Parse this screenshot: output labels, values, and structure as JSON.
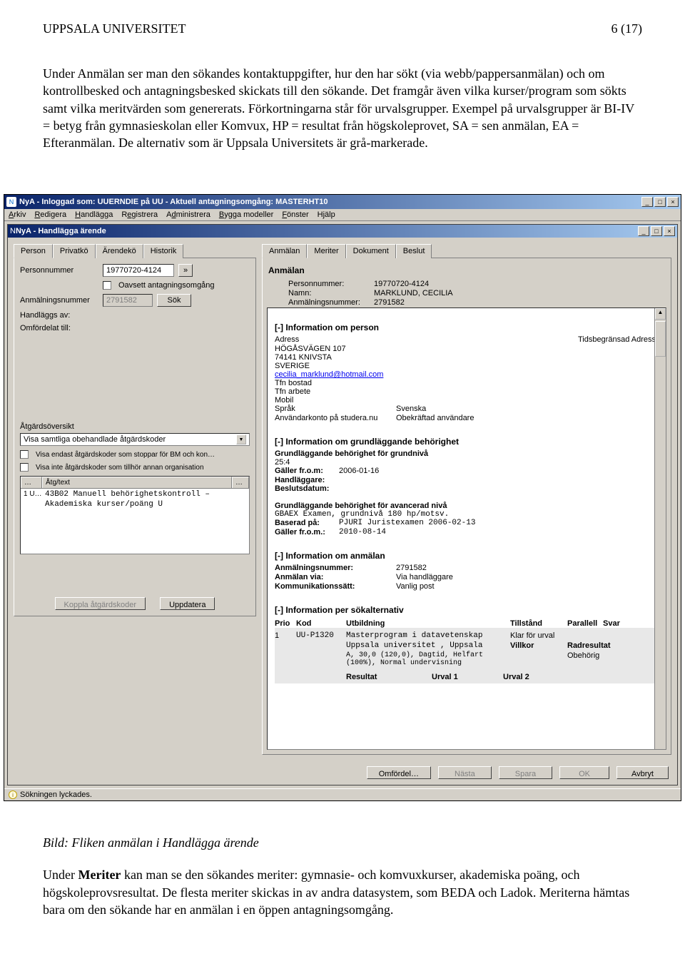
{
  "doc": {
    "org": "UPPSALA UNIVERSITET",
    "page": "6 (17)",
    "para1": "Under Anmälan ser man den sökandes kontaktuppgifter, hur den har sökt (via webb/pappersanmälan) och om kontrollbesked och antagningsbesked skickats till den sökande. Det framgår även vilka kurser/program som sökts samt vilka meritvärden som genererats. Förkortningarna står för urvalsgrupper. Exempel på urvalsgrupper är BI-IV = betyg från gymnasieskolan eller Komvux, HP = resultat från högskoleprovet, SA = sen anmälan, EA = Efteranmälan. De alternativ som är Uppsala Universitets är grå-markerade.",
    "caption": "Bild: Fliken anmälan i Handlägga ärende",
    "para2a": "Under ",
    "para2b": "Meriter",
    "para2c": " kan man se den sökandes meriter: gymnasie- och komvuxkurser, akademiska poäng, och högskoleprovsresultat. De flesta meriter skickas in av andra datasystem, som BEDA och Ladok. Meriterna hämtas bara om den sökande har en anmälan i en öppen antagningsomgång."
  },
  "app": {
    "title": "NyA - Inloggad som: UUERNDIE på UU - Aktuell antagningsomgång: MASTERHT10",
    "menu": [
      "Arkiv",
      "Redigera",
      "Handlägga",
      "Registrera",
      "Administrera",
      "Bygga modeller",
      "Fönster",
      "Hjälp"
    ],
    "innerTitle": "NyA - Handlägga ärende",
    "leftTabs": [
      "Person",
      "Privatkö",
      "Ärendekö",
      "Historik"
    ],
    "rightTabs": [
      "Anmälan",
      "Meriter",
      "Dokument",
      "Beslut"
    ],
    "left": {
      "pnrLabel": "Personnummer",
      "pnrValue": "19770720-4124",
      "oavsettLabel": "Oavsett antagningsomgång",
      "anmLabel": "Anmälningsnummer",
      "anmValue": "2791582",
      "sokBtn": "Sök",
      "handlaggsLabel": "Handläggs av:",
      "omfordelatLabel": "Omfördelat till:",
      "atgardLabel": "Åtgärdsöversikt",
      "atgardSelect": "Visa samtliga obehandlade åtgärdskoder",
      "chk1": "Visa endast åtgärdskoder som stoppar för BM och kon…",
      "chk2": "Visa inte åtgärdskoder som tillhör annan organisation",
      "listHeaders": [
        "…",
        "Åtg/text",
        "…"
      ],
      "listPrefix": "1 U…",
      "listRow": "43B02 Manuell behörighetskontroll – Akademiska kurser/poäng U",
      "kopplaBtn": "Koppla åtgärdskoder",
      "uppdateraBtn": "Uppdatera"
    },
    "right": {
      "head": "Anmälan",
      "pnrL": "Personnummer:",
      "pnrV": "19770720-4124",
      "namnL": "Namn:",
      "namnV": "MARKLUND, CECILIA",
      "anmL": "Anmälningsnummer:",
      "anmV": "2791582",
      "secPerson": "[-] Information om person",
      "adressL": "Adress",
      "tidsL": "Tidsbegränsad Adress",
      "adr1": "HÖGÅSVÄGEN 107",
      "adr2": "74141 KNIVSTA",
      "adr3": "SVERIGE",
      "email": "cecilia_marklund@hotmail.com",
      "tfnB": "Tfn bostad",
      "tfnA": "Tfn arbete",
      "mobil": "Mobil",
      "sprakL": "Språk",
      "sprakV": "Svenska",
      "kontoL": "Användarkonto på studera.nu",
      "kontoV": "Obekräftad användare",
      "secGrund": "[-] Information om grundläggande behörighet",
      "grund1": "Grundläggande behörighet för grundnivå",
      "grund2": "25:4",
      "grund3L": "Gäller fr.o.m:",
      "grund3V": "2006-01-16",
      "grund4L": "Handläggare:",
      "grund5L": "Beslutsdatum:",
      "avanc1": "Grundläggande behörighet för avancerad nivå",
      "avanc2": "GBAEX   Examen, grundnivå 180 hp/motsv.",
      "avanc3L": "Baserad på:",
      "avanc3V": "PJURI  Juristexamen  2006-02-13",
      "avanc4L": "Gäller fr.o.m.:",
      "avanc4V": "2010-08-14",
      "secAnm": "[-] Information om anmälan",
      "anm1L": "Anmälningsnummer:",
      "anm1V": "2791582",
      "anm2L": "Anmälan via:",
      "anm2V": "Via handläggare",
      "anm3L": "Kommunikationssätt:",
      "anm3V": "Vanlig post",
      "secAlt": "[-] Information per sökalternativ",
      "th": {
        "prio": "Prio",
        "kod": "Kod",
        "utb": "Utbildning",
        "till": "Tillstånd",
        "par": "Parallell",
        "svar": "Svar"
      },
      "row": {
        "prio": "1",
        "kod": "UU-P1320",
        "utb1": "Masterprogram i datavetenskap",
        "utb2": "Uppsala universitet , Uppsala",
        "utb3": "A, 30,0 (120,0), Dagtid, Helfart (100%), Normal undervisning",
        "till": "Klar för urval",
        "vilL": "Villkor",
        "radL": "Radresultat",
        "radV": "Obehörig"
      },
      "resHead": {
        "res": "Resultat",
        "u1": "Urval 1",
        "u2": "Urval 2"
      }
    },
    "bottom": {
      "omf": "Omfördel…",
      "nasta": "Nästa",
      "spara": "Spara",
      "ok": "OK",
      "avbryt": "Avbryt"
    },
    "status": "Sökningen lyckades."
  }
}
